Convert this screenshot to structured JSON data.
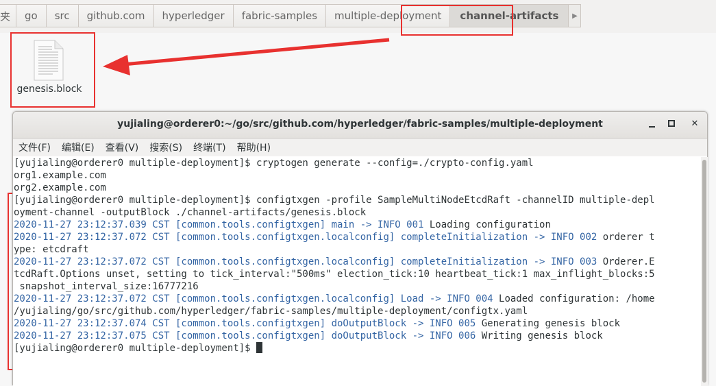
{
  "breadcrumbs": [
    {
      "label": "夹"
    },
    {
      "label": "go"
    },
    {
      "label": "src"
    },
    {
      "label": "github.com"
    },
    {
      "label": "hyperledger"
    },
    {
      "label": "fabric-samples"
    },
    {
      "label": "multiple-deployment"
    },
    {
      "label": "channel-artifacts"
    }
  ],
  "scroll_arrow": "▶",
  "file": {
    "name": "genesis.block",
    "icon": "text-file-icon"
  },
  "terminal": {
    "title": "yujialing@orderer0:~/go/src/github.com/hyperledger/fabric-samples/multiple-deployment",
    "window_buttons": {
      "minimize": "▬",
      "maximize": "◘",
      "close": "✕"
    },
    "menu": [
      "文件(F)",
      "编辑(E)",
      "查看(V)",
      "搜索(S)",
      "终端(T)",
      "帮助(H)"
    ],
    "lines": [
      {
        "text": "[yujialing@orderer0 multiple-deployment]$ cryptogen generate --config=./crypto-config.yaml"
      },
      {
        "text": "org1.example.com"
      },
      {
        "text": "org2.example.com"
      },
      {
        "text": "[yujialing@orderer0 multiple-deployment]$ configtxgen -profile SampleMultiNodeEtcdRaft -channelID multiple-depl"
      },
      {
        "text": "oyment-channel -outputBlock ./channel-artifacts/genesis.block"
      },
      {
        "ts": "2020-11-27 23:12:37.039 CST [common.tools.configtxgen] main -> INFO 001",
        "text": " Loading configuration"
      },
      {
        "ts": "2020-11-27 23:12:37.072 CST [common.tools.configtxgen.localconfig] completeInitialization -> INFO 002",
        "text": " orderer t"
      },
      {
        "text": "ype: etcdraft"
      },
      {
        "ts": "2020-11-27 23:12:37.072 CST [common.tools.configtxgen.localconfig] completeInitialization -> INFO 003",
        "text": " Orderer.E"
      },
      {
        "text": "tcdRaft.Options unset, setting to tick_interval:\"500ms\" election_tick:10 heartbeat_tick:1 max_inflight_blocks:5"
      },
      {
        "text": " snapshot_interval_size:16777216"
      },
      {
        "ts": "2020-11-27 23:12:37.072 CST [common.tools.configtxgen.localconfig] Load -> INFO 004",
        "text": " Loaded configuration: /home"
      },
      {
        "text": "/yujialing/go/src/github.com/hyperledger/fabric-samples/multiple-deployment/configtx.yaml"
      },
      {
        "ts": "2020-11-27 23:12:37.074 CST [common.tools.configtxgen] doOutputBlock -> INFO 005",
        "text": " Generating genesis block"
      },
      {
        "ts": "2020-11-27 23:12:37.075 CST [common.tools.configtxgen] doOutputBlock -> INFO 006",
        "text": " Writing genesis block"
      },
      {
        "text": "[yujialing@orderer0 multiple-deployment]$ ",
        "cursor": true
      }
    ]
  },
  "colors": {
    "highlight": "#e8312f",
    "log_blue": "#3465a4",
    "arrow": "#e8312f"
  }
}
